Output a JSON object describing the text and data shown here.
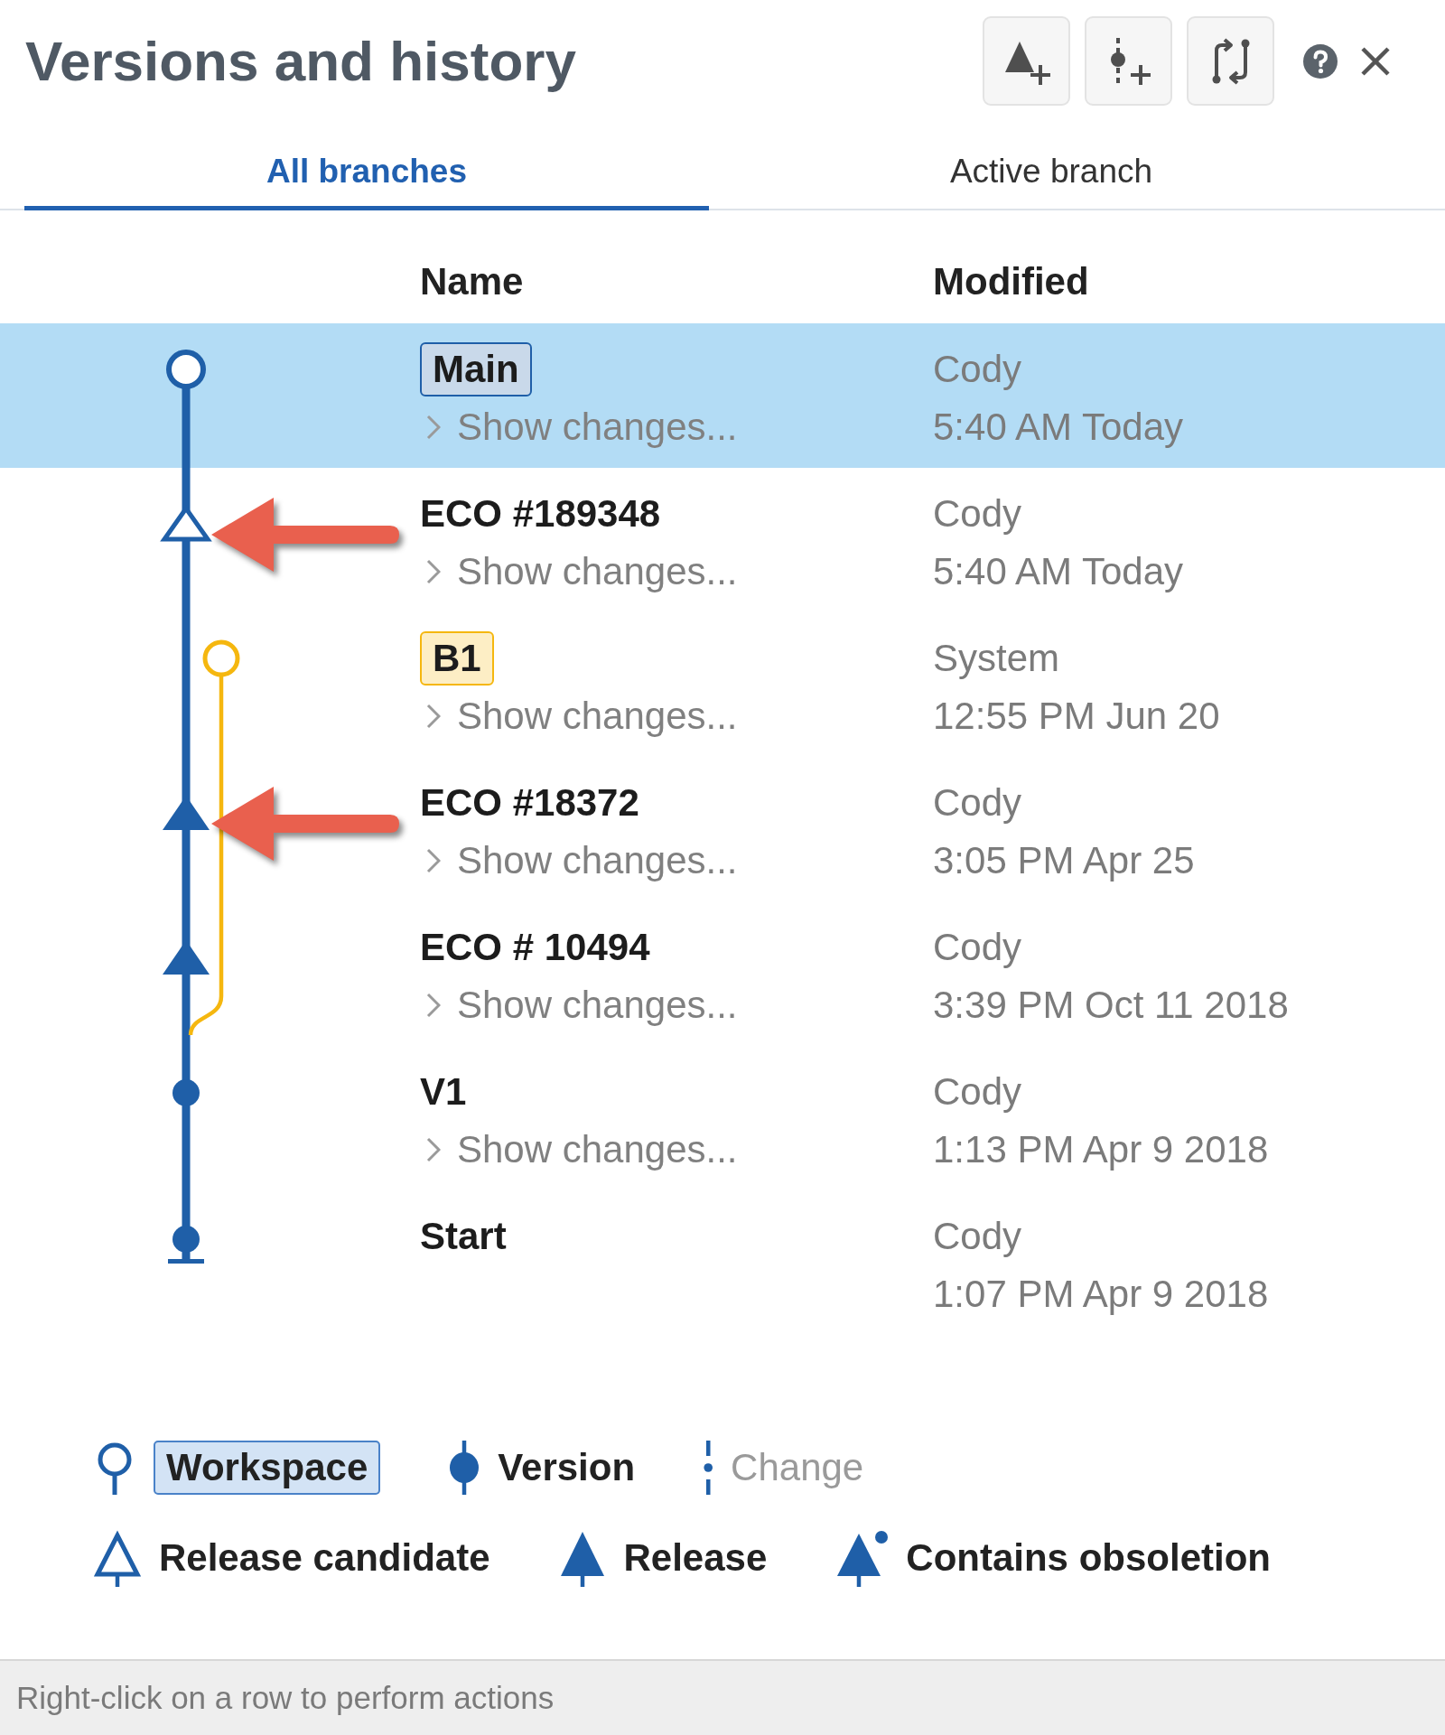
{
  "window": {
    "title": "Versions and history"
  },
  "tabs": [
    {
      "label": "All branches",
      "selected": true
    },
    {
      "label": "Active branch",
      "selected": false
    }
  ],
  "table": {
    "columns": [
      "Name",
      "Modified"
    ],
    "rows": [
      {
        "name": "Main",
        "kind": "workspace",
        "color": "#1f5fa8",
        "changes_link": "Show changes...",
        "author": "Cody",
        "time": "5:40 AM Today",
        "selected": true,
        "callout_arrow": false
      },
      {
        "name": "ECO #189348",
        "kind": "release-candidate",
        "color": "#1f5fa8",
        "changes_link": "Show changes...",
        "author": "Cody",
        "time": "5:40 AM Today",
        "selected": false,
        "callout_arrow": true
      },
      {
        "name": "B1",
        "kind": "workspace",
        "color": "#f5b70f",
        "changes_link": "Show changes...",
        "author": "System",
        "time": "12:55 PM Jun 20",
        "selected": false,
        "callout_arrow": false
      },
      {
        "name": "ECO #18372",
        "kind": "release",
        "color": "#1f5fa8",
        "changes_link": "Show changes...",
        "author": "Cody",
        "time": "3:05 PM Apr 25",
        "selected": false,
        "callout_arrow": true
      },
      {
        "name": "ECO # 10494",
        "kind": "release",
        "color": "#1f5fa8",
        "changes_link": "Show changes...",
        "author": "Cody",
        "time": "3:39 PM Oct 11 2018",
        "selected": false,
        "callout_arrow": false
      },
      {
        "name": "V1",
        "kind": "version",
        "color": "#1f5fa8",
        "changes_link": "Show changes...",
        "author": "Cody",
        "time": "1:13 PM Apr 9 2018",
        "selected": false,
        "callout_arrow": false
      },
      {
        "name": "Start",
        "kind": "start",
        "color": "#1f5fa8",
        "author": "Cody",
        "time": "1:07 PM Apr 9 2018",
        "selected": false,
        "callout_arrow": false
      }
    ]
  },
  "legend": {
    "rows": [
      [
        {
          "kind": "workspace",
          "label": "Workspace"
        },
        {
          "kind": "version",
          "label": "Version"
        },
        {
          "kind": "change",
          "label": "Change"
        }
      ],
      [
        {
          "kind": "release-candidate",
          "label": "Release candidate"
        },
        {
          "kind": "release",
          "label": "Release"
        },
        {
          "kind": "obsoletion",
          "label": "Contains obsoletion"
        }
      ]
    ]
  },
  "status_bar": "Right-click on a row to perform actions"
}
